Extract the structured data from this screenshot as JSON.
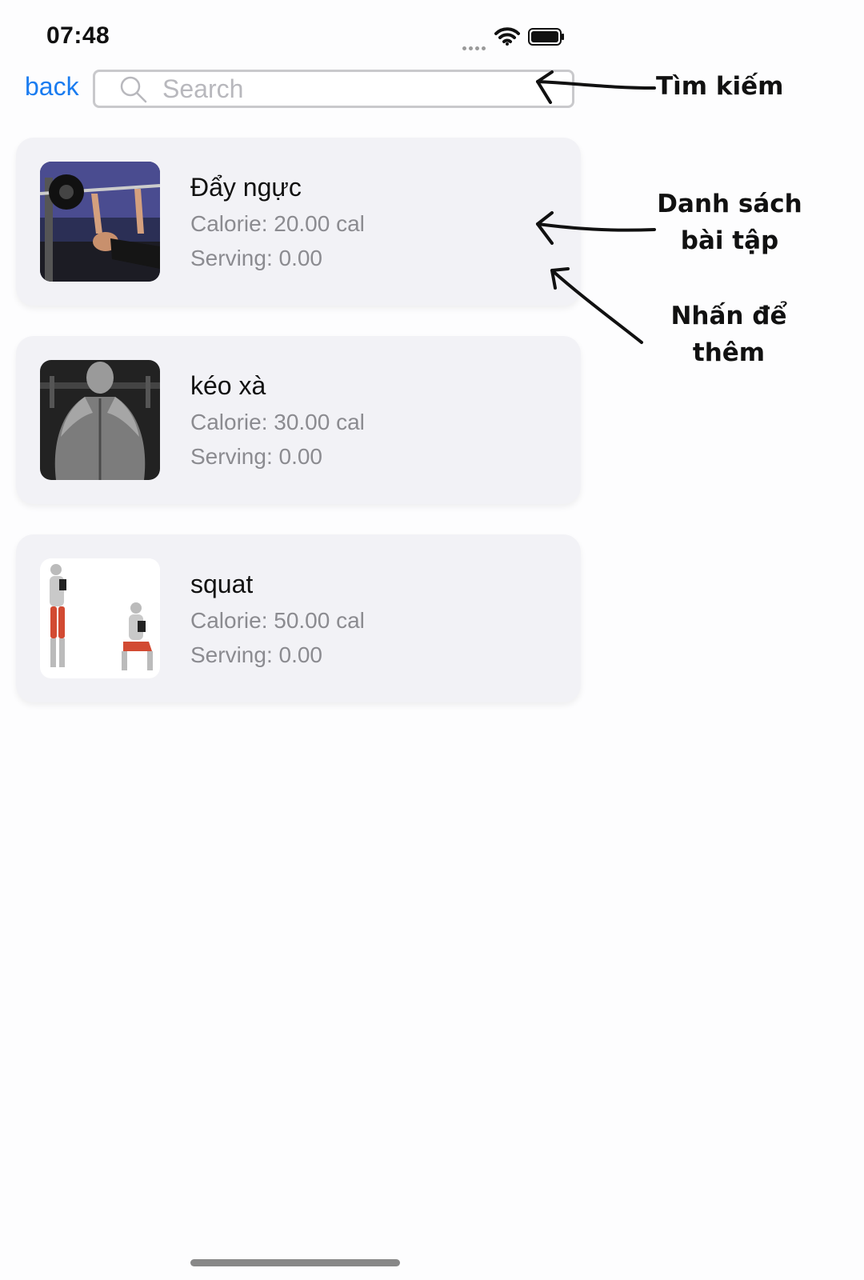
{
  "status_bar": {
    "time": "07:48"
  },
  "nav": {
    "back_label": "back",
    "search_placeholder": "Search",
    "search_value": ""
  },
  "exercises": [
    {
      "name": "Đẩy ngực",
      "calorie": "Calorie: 20.00 cal",
      "serving": "Serving: 0.00",
      "image": "bench-press-photo"
    },
    {
      "name": "kéo xà",
      "calorie": "Calorie: 30.00 cal",
      "serving": "Serving: 0.00",
      "image": "back-muscles-photo"
    },
    {
      "name": "squat",
      "calorie": "Calorie: 50.00 cal",
      "serving": "Serving: 0.00",
      "image": "squat-illustration"
    }
  ],
  "annotations": {
    "search": "Tìm kiếm",
    "list_line1": "Danh sách",
    "list_line2": "bài tập",
    "tap_line1": "Nhấn để",
    "tap_line2": "thêm"
  },
  "colors": {
    "accent": "#1a7cf0",
    "card_background": "#f2f2f6",
    "secondary_text": "#8b8b90"
  }
}
